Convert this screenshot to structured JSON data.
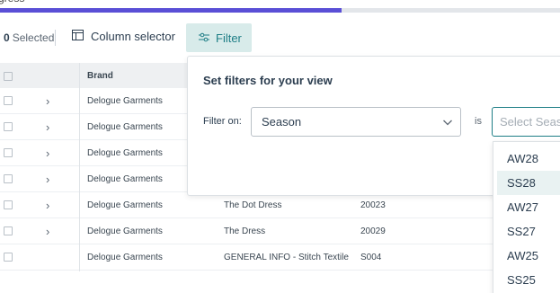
{
  "progress": {
    "label": "gress",
    "fraction": 0.61
  },
  "toolbar": {
    "selected_count": "0",
    "selected_label": "Selected",
    "column_selector_label": "Column selector",
    "filter_label": "Filter"
  },
  "grid": {
    "headers": {
      "brand": "Brand"
    },
    "rows": [
      {
        "brand": "Delogue Garments",
        "name": "",
        "code": ""
      },
      {
        "brand": "Delogue Garments",
        "name": "",
        "code": ""
      },
      {
        "brand": "Delogue Garments",
        "name": "",
        "code": ""
      },
      {
        "brand": "Delogue Garments",
        "name": "",
        "code": ""
      },
      {
        "brand": "Delogue Garments",
        "name": "The Dot Dress",
        "code": "20023"
      },
      {
        "brand": "Delogue Garments",
        "name": "The Dress",
        "code": "20029"
      },
      {
        "brand": "Delogue Garments",
        "name": "GENERAL INFO - Stitch Textile",
        "code": "S004"
      }
    ],
    "expander_glyph": "›"
  },
  "filter_panel": {
    "title": "Set filters for your view",
    "filter_on_label": "Filter on:",
    "field_value": "Season",
    "operator_label": "is",
    "value_placeholder": "Select Season"
  },
  "season_options": [
    "AW28",
    "SS28",
    "AW27",
    "SS27",
    "AW25",
    "SS25"
  ],
  "colors": {
    "accent": "#1e7e86",
    "accent_bg": "#d8ebea",
    "progress": "#5a4fd6"
  }
}
